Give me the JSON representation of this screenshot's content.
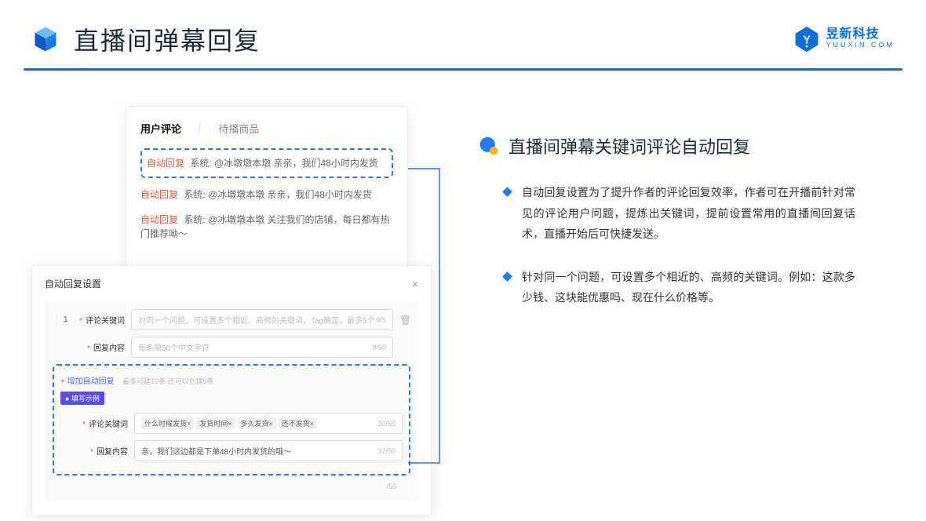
{
  "header": {
    "title": "直播间弹幕回复",
    "logo_main": "昱新科技",
    "logo_sub": "YUUXIN.COM"
  },
  "comments": {
    "tab_active": "用户评论",
    "tab_inactive": "待播商品",
    "items": [
      {
        "tag": "自动回复",
        "text": "系统: @冰墩墩本墩 亲亲，我们48小时内发货"
      },
      {
        "tag": "自动回复",
        "text": "系统: @冰墩墩本墩 亲亲，我们48小时内发货"
      },
      {
        "tag": "自动回复",
        "text": "系统: @冰墩墩本墩 关注我们的店铺，每日都有热门推荐呦～"
      }
    ]
  },
  "settings": {
    "title": "自动回复设置",
    "row_num": "1",
    "label_keyword": "评论关键词",
    "ph_keyword": "对同一个问题，可设置多个相近、高频的关键词，Tag确定，最多5个",
    "cnt_keyword": "0/5",
    "label_content": "回复内容",
    "ph_content": "每条限50个中文字符",
    "cnt_content": "0/50",
    "add_link": "+ 增加自动回复",
    "add_hint": "最多可建10条 还可以创建9条",
    "example_badge": "● 填写示例",
    "ex_kw_label": "评论关键词",
    "ex_tags": [
      "什么时候发货×",
      "发货时间×",
      "多久发货×",
      "还不发货×"
    ],
    "ex_kw_cnt": "20/50",
    "ex_ct_label": "回复内容",
    "ex_ct_val": "亲，我们这边都是下单48小时内发货的哦～",
    "ex_ct_cnt": "37/50",
    "tail_cnt": "/50"
  },
  "right": {
    "title": "直播间弹幕关键词评论自动回复",
    "p1": "自动回复设置为了提升作者的评论回复效率，作者可在开播前针对常见的评论用户问题，提炼出关键词，提前设置常用的直播间回复话术，直播开始后可快捷发送。",
    "p2": "针对同一个问题，可设置多个相近的、高频的关键词。例如：这款多少钱、这块能优惠吗、现在什么价格等。"
  }
}
